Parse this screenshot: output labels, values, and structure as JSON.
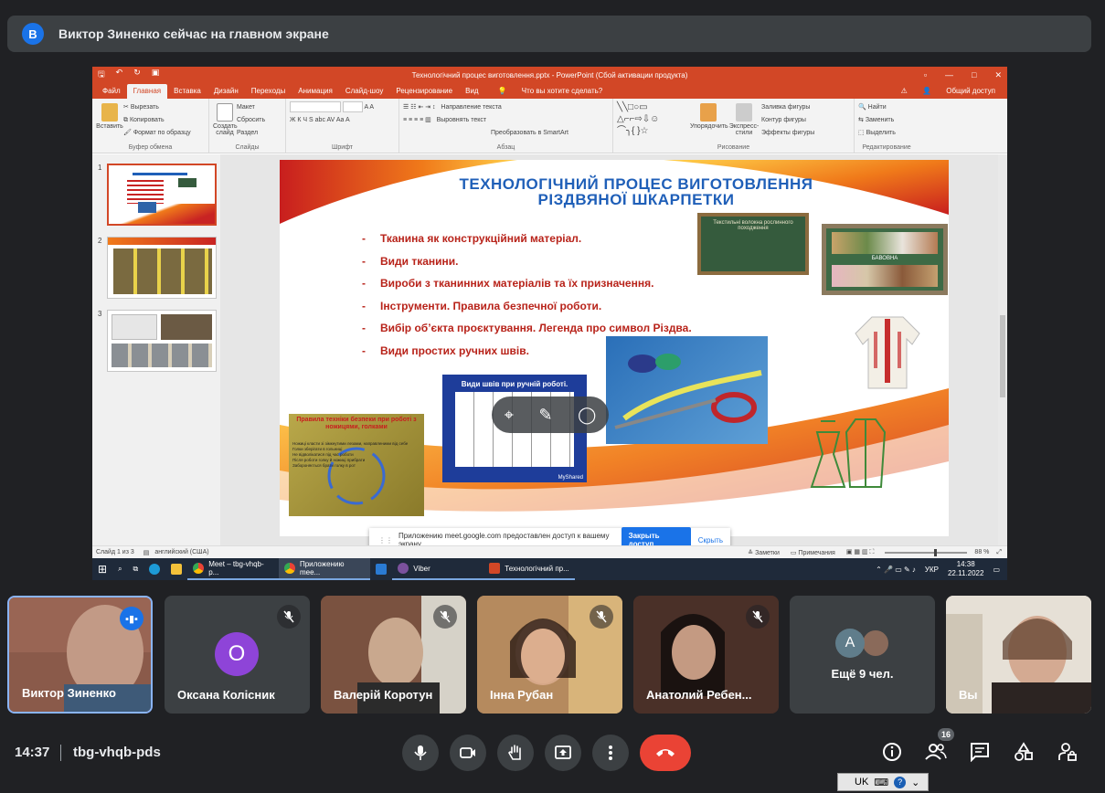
{
  "banner": {
    "avatar_letter": "В",
    "text": "Виктор Зиненко сейчас на главном экране"
  },
  "ppt": {
    "window_title": "Технологічний процес виготовлення.pptx - PowerPoint (Сбой активации продукта)",
    "tabs": [
      "Файл",
      "Главная",
      "Вставка",
      "Дизайн",
      "Переходы",
      "Анимация",
      "Слайд-шоу",
      "Рецензирование",
      "Вид"
    ],
    "tell_me": "Что вы хотите сделать?",
    "share": "Общий доступ",
    "ribbon": {
      "clipboard": {
        "paste": "Вставить",
        "cut": "Вырезать",
        "copy": "Копировать",
        "format": "Формат по образцу",
        "label": "Буфер обмена"
      },
      "slides": {
        "new": "Создать слайд",
        "layout": "Макет",
        "reset": "Сбросить",
        "section": "Раздел",
        "label": "Слайды"
      },
      "font": {
        "label": "Шрифт",
        "styles": "Ж  К  Ч  S  abc  AV  Aa  A"
      },
      "paragraph": {
        "direction": "Направление текста",
        "align": "Выровнять текст",
        "smartart": "Преобразовать в SmartArt",
        "label": "Абзац"
      },
      "drawing": {
        "arrange": "Упорядочить",
        "express": "Экспресс-стили",
        "fill": "Заливка фигуры",
        "outline": "Контур фигуры",
        "effects": "Эффекты фигуры",
        "label": "Рисование"
      },
      "editing": {
        "find": "Найти",
        "replace": "Заменить",
        "select": "Выделить",
        "label": "Редактирование"
      }
    },
    "thumb_numbers": [
      "1",
      "2",
      "3"
    ],
    "slide": {
      "title_line1": "ТЕХНОЛОГІЧНИЙ ПРОЦЕС ВИГОТОВЛЕННЯ",
      "title_line2": "РІЗДВЯНОЇ ШКАРПЕТКИ",
      "bullets": [
        "Тканина як конструкційний матеріал.",
        "Види тканини.",
        "Вироби з тканинних матеріалів та їх призначення.",
        "Інструменти. Правила безпечної роботи.",
        "Вибір об’єкта проєктування. Легенда про символ Різдва.",
        "Види простих ручних швів."
      ],
      "board_title": "Текстильні волокна рослинного походження",
      "cotton_label": "БАВОВНА",
      "stitches_title": "Види швів при ручній роботі.",
      "stitches_brand": "MyShared",
      "safety_title": "Правила техніки безпеки при роботі з ножицями, голками",
      "safety_items": [
        "Ножиці класти зі зімкнутими лезами, направленими від себе",
        "Голки зберігати в гольниці",
        "Не відволікатися під час роботи",
        "Після роботи голку й ножиці прибрати",
        "Забороняється брати голку в рот"
      ]
    },
    "notify": {
      "text": "Приложению meet.google.com предоставлен доступ к вашему экрану.",
      "stop": "Закрыть доступ",
      "hide": "Скрыть"
    },
    "status": {
      "slide": "Слайд 1 из 3",
      "lang": "английский (США)",
      "notes": "Заметки",
      "comments": "Примечания",
      "zoom": "88 %"
    },
    "taskbar": {
      "apps": [
        "Meet – tbg-vhqb-p...",
        "Приложению mee...",
        "Viber",
        "Технологічний пр..."
      ],
      "lang": "УКР",
      "time": "14:38",
      "date": "22.11.2022"
    }
  },
  "participants": [
    {
      "name": "Виктор Зиненко",
      "speaking": true
    },
    {
      "name": "Оксана Колісник",
      "avatar_letter": "О",
      "avatar_color": "#8e44d8"
    },
    {
      "name": "Валерій Коротун"
    },
    {
      "name": "Інна Рубан"
    },
    {
      "name": "Анатолий Ребен..."
    },
    {
      "name": "Ещё 9 чел.",
      "avatar_letter": "А"
    },
    {
      "name": "Вы"
    }
  ],
  "meeting": {
    "time": "14:37",
    "code": "tbg-vhqb-pds",
    "participants_count": "16"
  },
  "langbar": {
    "lang": "UK"
  }
}
